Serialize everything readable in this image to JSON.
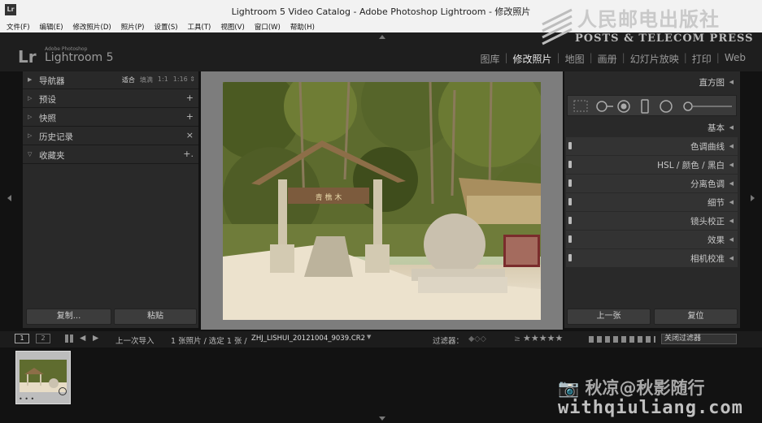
{
  "window": {
    "title": "Lightroom 5 Video Catalog - Adobe Photoshop Lightroom - 修改照片"
  },
  "menu": [
    "文件(F)",
    "编辑(E)",
    "修改照片(D)",
    "照片(P)",
    "设置(S)",
    "工具(T)",
    "视图(V)",
    "窗口(W)",
    "帮助(H)"
  ],
  "watermark_top": {
    "cn": "人民邮电出版社",
    "en": "POSTS & TELECOM PRESS"
  },
  "brand": {
    "logo": "Lr",
    "small": "Adobe Photoshop",
    "name": "Lightroom 5"
  },
  "modules": [
    {
      "label": "图库",
      "active": false
    },
    {
      "label": "修改照片",
      "active": true
    },
    {
      "label": "地图",
      "active": false
    },
    {
      "label": "画册",
      "active": false
    },
    {
      "label": "幻灯片放映",
      "active": false
    },
    {
      "label": "打印",
      "active": false
    },
    {
      "label": "Web",
      "active": false
    }
  ],
  "left_panel": {
    "navigator": {
      "label": "导航器",
      "options": [
        "适合",
        "填满",
        "1:1",
        "1:16 ⇕"
      ],
      "selected": "适合"
    },
    "sections": [
      {
        "label": "预设",
        "action": "+"
      },
      {
        "label": "快照",
        "action": "+"
      },
      {
        "label": "历史记录",
        "action": "×"
      },
      {
        "label": "收藏夹",
        "action": "+."
      }
    ],
    "buttons": {
      "copy": "复制...",
      "paste": "粘贴"
    }
  },
  "right_panel": {
    "histogram": "直方图",
    "sections": [
      "基本",
      "色调曲线",
      "HSL / 颜色 / 黑白",
      "分离色调",
      "细节",
      "镜头校正",
      "效果",
      "相机校准"
    ],
    "buttons": {
      "previous": "上一张",
      "reset": "复位"
    }
  },
  "photo": {
    "sign_text": "青 樵 木"
  },
  "filmstrip_bar": {
    "view1": "1",
    "view2": "2",
    "source": "上一次导入",
    "info": "1 张照片 / 选定 1 张 /",
    "filename": "ZHJ_LISHUI_20121004_9039.CR2",
    "filter_label": "过滤器：",
    "stars": "★★★★★",
    "filter_dropdown": "关闭过滤器"
  },
  "thumbnail": {
    "dots": "• • •"
  },
  "watermark_bottom": {
    "text": "📷 秋凉@秋影随行",
    "url": "withqiuliang.com"
  }
}
